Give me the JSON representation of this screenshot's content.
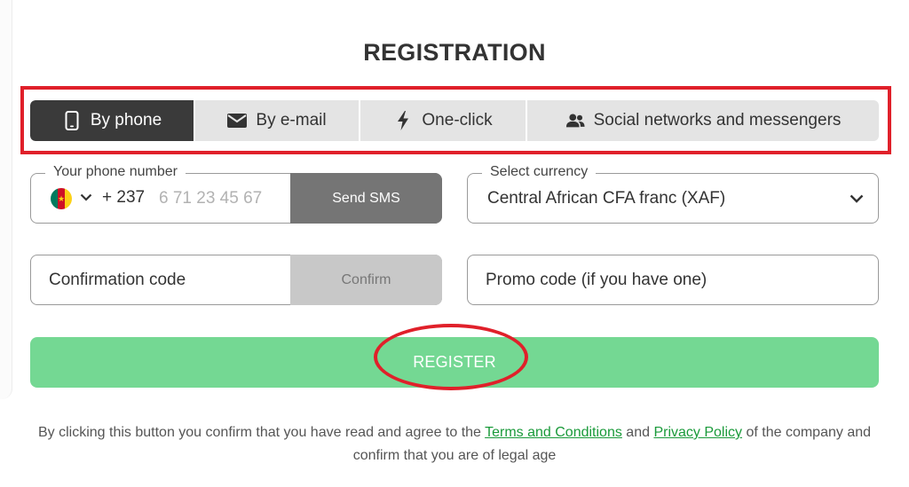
{
  "form": {
    "title": "REGISTRATION"
  },
  "tabs": [
    {
      "label": "By phone",
      "icon": "smartphone-icon",
      "active": true
    },
    {
      "label": "By e-mail",
      "icon": "envelope-icon",
      "active": false
    },
    {
      "label": "One-click",
      "icon": "lightning-icon",
      "active": false
    },
    {
      "label": "Social networks and messengers",
      "icon": "users-icon",
      "active": false
    }
  ],
  "phone": {
    "legend": "Your phone number",
    "country_flag": "cameroon-flag-icon",
    "dial_code": "+ 237",
    "placeholder": "6 71 23 45 67",
    "send_sms_label": "Send SMS"
  },
  "currency": {
    "legend": "Select currency",
    "selected": "Central African CFA franc (XAF)"
  },
  "confirmation": {
    "placeholder": "Confirmation code",
    "confirm_label": "Confirm"
  },
  "promo": {
    "placeholder": "Promo code (if you have one)"
  },
  "register": {
    "label": "REGISTER"
  },
  "terms": {
    "text_before": "By clicking this button you confirm that you have read and agree to the ",
    "terms_link": "Terms and Conditions",
    "text_middle": " and ",
    "privacy_link": "Privacy Policy",
    "text_after": " of the company and confirm that you are of legal age"
  },
  "colors": {
    "active_tab": "#3a3a3a",
    "register_button": "#74d893",
    "link": "#1a9a3a",
    "annotation_red": "#e0202a"
  }
}
